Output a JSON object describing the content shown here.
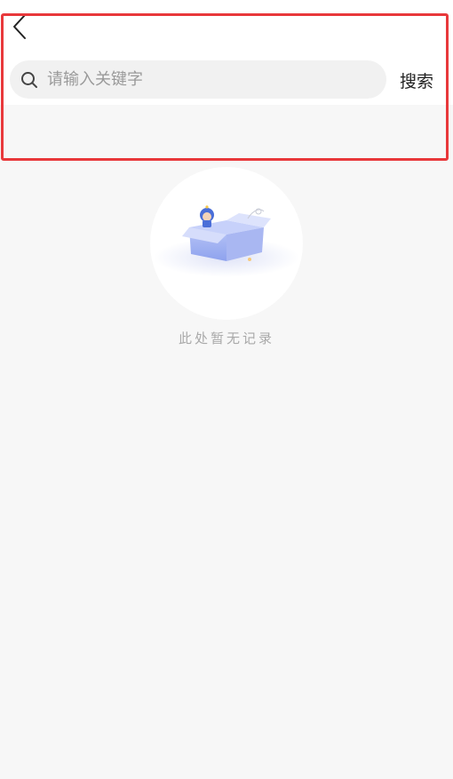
{
  "header": {
    "back_icon": "chevron-left-icon"
  },
  "search": {
    "icon": "search-icon",
    "placeholder": "请输入关键字",
    "value": "",
    "button_label": "搜索"
  },
  "empty_state": {
    "illustration": "empty-box-illustration",
    "message": "此处暂无记录"
  },
  "colors": {
    "page_background": "#f7f7f7",
    "header_background": "#ffffff",
    "search_background": "#f1f1f1",
    "highlight_border": "#e8383b",
    "muted_text": "#a9a9a9"
  }
}
